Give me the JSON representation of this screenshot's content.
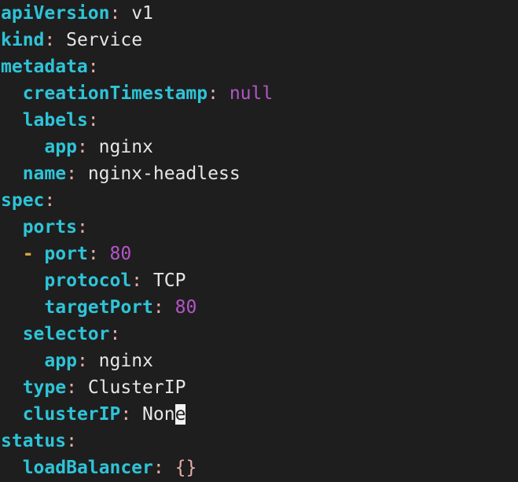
{
  "terminal": {
    "background_color": "#1e1e1e",
    "cursor_color": "#f2f2f2",
    "palette": {
      "key": "#2ec4d8",
      "punctuation": "#e8b0a8",
      "value": "#e6e6e6",
      "scalar": "#b455c8",
      "dash": "#d7a640"
    },
    "document_kind": "kubernetes-service-yaml",
    "lines": [
      {
        "indent": "",
        "tokens": [
          {
            "type": "key",
            "text": "apiVersion"
          },
          {
            "type": "punctuation",
            "text": ":"
          },
          {
            "type": "space",
            "text": " "
          },
          {
            "type": "value",
            "text": "v1"
          }
        ]
      },
      {
        "indent": "",
        "tokens": [
          {
            "type": "key",
            "text": "kind"
          },
          {
            "type": "punctuation",
            "text": ":"
          },
          {
            "type": "space",
            "text": " "
          },
          {
            "type": "value",
            "text": "Service"
          }
        ]
      },
      {
        "indent": "",
        "tokens": [
          {
            "type": "key",
            "text": "metadata"
          },
          {
            "type": "punctuation",
            "text": ":"
          }
        ]
      },
      {
        "indent": "  ",
        "tokens": [
          {
            "type": "key",
            "text": "creationTimestamp"
          },
          {
            "type": "punctuation",
            "text": ":"
          },
          {
            "type": "space",
            "text": " "
          },
          {
            "type": "scalar",
            "text": "null"
          }
        ]
      },
      {
        "indent": "  ",
        "tokens": [
          {
            "type": "key",
            "text": "labels"
          },
          {
            "type": "punctuation",
            "text": ":"
          }
        ]
      },
      {
        "indent": "    ",
        "tokens": [
          {
            "type": "key",
            "text": "app"
          },
          {
            "type": "punctuation",
            "text": ":"
          },
          {
            "type": "space",
            "text": " "
          },
          {
            "type": "value",
            "text": "nginx"
          }
        ]
      },
      {
        "indent": "  ",
        "tokens": [
          {
            "type": "key",
            "text": "name"
          },
          {
            "type": "punctuation",
            "text": ":"
          },
          {
            "type": "space",
            "text": " "
          },
          {
            "type": "value",
            "text": "nginx-headless"
          }
        ]
      },
      {
        "indent": "",
        "tokens": [
          {
            "type": "key",
            "text": "spec"
          },
          {
            "type": "punctuation",
            "text": ":"
          }
        ]
      },
      {
        "indent": "  ",
        "tokens": [
          {
            "type": "key",
            "text": "ports"
          },
          {
            "type": "punctuation",
            "text": ":"
          }
        ]
      },
      {
        "indent": "  ",
        "tokens": [
          {
            "type": "dash",
            "text": "-"
          },
          {
            "type": "space",
            "text": " "
          },
          {
            "type": "key",
            "text": "port"
          },
          {
            "type": "punctuation",
            "text": ":"
          },
          {
            "type": "space",
            "text": " "
          },
          {
            "type": "scalar",
            "text": "80"
          }
        ]
      },
      {
        "indent": "    ",
        "tokens": [
          {
            "type": "key",
            "text": "protocol"
          },
          {
            "type": "punctuation",
            "text": ":"
          },
          {
            "type": "space",
            "text": " "
          },
          {
            "type": "value",
            "text": "TCP"
          }
        ]
      },
      {
        "indent": "    ",
        "tokens": [
          {
            "type": "key",
            "text": "targetPort"
          },
          {
            "type": "punctuation",
            "text": ":"
          },
          {
            "type": "space",
            "text": " "
          },
          {
            "type": "scalar",
            "text": "80"
          }
        ]
      },
      {
        "indent": "  ",
        "tokens": [
          {
            "type": "key",
            "text": "selector"
          },
          {
            "type": "punctuation",
            "text": ":"
          }
        ]
      },
      {
        "indent": "    ",
        "tokens": [
          {
            "type": "key",
            "text": "app"
          },
          {
            "type": "punctuation",
            "text": ":"
          },
          {
            "type": "space",
            "text": " "
          },
          {
            "type": "value",
            "text": "nginx"
          }
        ]
      },
      {
        "indent": "  ",
        "tokens": [
          {
            "type": "key",
            "text": "type"
          },
          {
            "type": "punctuation",
            "text": ":"
          },
          {
            "type": "space",
            "text": " "
          },
          {
            "type": "value",
            "text": "ClusterIP"
          }
        ]
      },
      {
        "indent": "  ",
        "tokens": [
          {
            "type": "key",
            "text": "clusterIP"
          },
          {
            "type": "punctuation",
            "text": ":"
          },
          {
            "type": "space",
            "text": " "
          },
          {
            "type": "value",
            "text": "Non"
          },
          {
            "type": "cursor",
            "text": "e"
          }
        ]
      },
      {
        "indent": "",
        "tokens": [
          {
            "type": "key",
            "text": "status"
          },
          {
            "type": "punctuation",
            "text": ":"
          }
        ]
      },
      {
        "indent": "  ",
        "tokens": [
          {
            "type": "key",
            "text": "loadBalancer"
          },
          {
            "type": "punctuation",
            "text": ":"
          },
          {
            "type": "space",
            "text": " "
          },
          {
            "type": "punctuation",
            "text": "{}"
          }
        ]
      }
    ]
  }
}
